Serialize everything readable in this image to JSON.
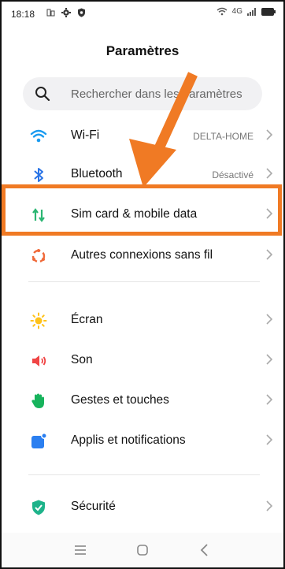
{
  "status_bar": {
    "time": "18:18",
    "network": "4G"
  },
  "header": {
    "title": "Paramètres"
  },
  "search": {
    "placeholder": "Rechercher dans les paramètres"
  },
  "settings": [
    {
      "label": "Wi-Fi",
      "value": "DELTA-HOME",
      "icon": "wifi-icon"
    },
    {
      "label": "Bluetooth",
      "value": "Désactivé",
      "icon": "bluetooth-icon"
    },
    {
      "label": "Sim card & mobile data",
      "value": "",
      "icon": "mobile-data-icon"
    },
    {
      "label": "Autres connexions sans fil",
      "value": "",
      "icon": "wireless-connections-icon"
    },
    {
      "label": "Écran",
      "value": "",
      "icon": "brightness-icon"
    },
    {
      "label": "Son",
      "value": "",
      "icon": "sound-icon"
    },
    {
      "label": "Gestes et touches",
      "value": "",
      "icon": "gestures-icon"
    },
    {
      "label": "Applis et notifications",
      "value": "",
      "icon": "apps-notifications-icon"
    },
    {
      "label": "Sécurité",
      "value": "",
      "icon": "security-icon"
    }
  ],
  "colors": {
    "highlight": "#f07a24",
    "wifi": "#1a9bf0",
    "bluetooth": "#2a74e6",
    "mobile_data": "#2bb673",
    "brightness": "#ffc21a",
    "sound": "#f04545",
    "gestures": "#17b35c",
    "apps": "#2b7ff0",
    "security": "#1db38a"
  }
}
